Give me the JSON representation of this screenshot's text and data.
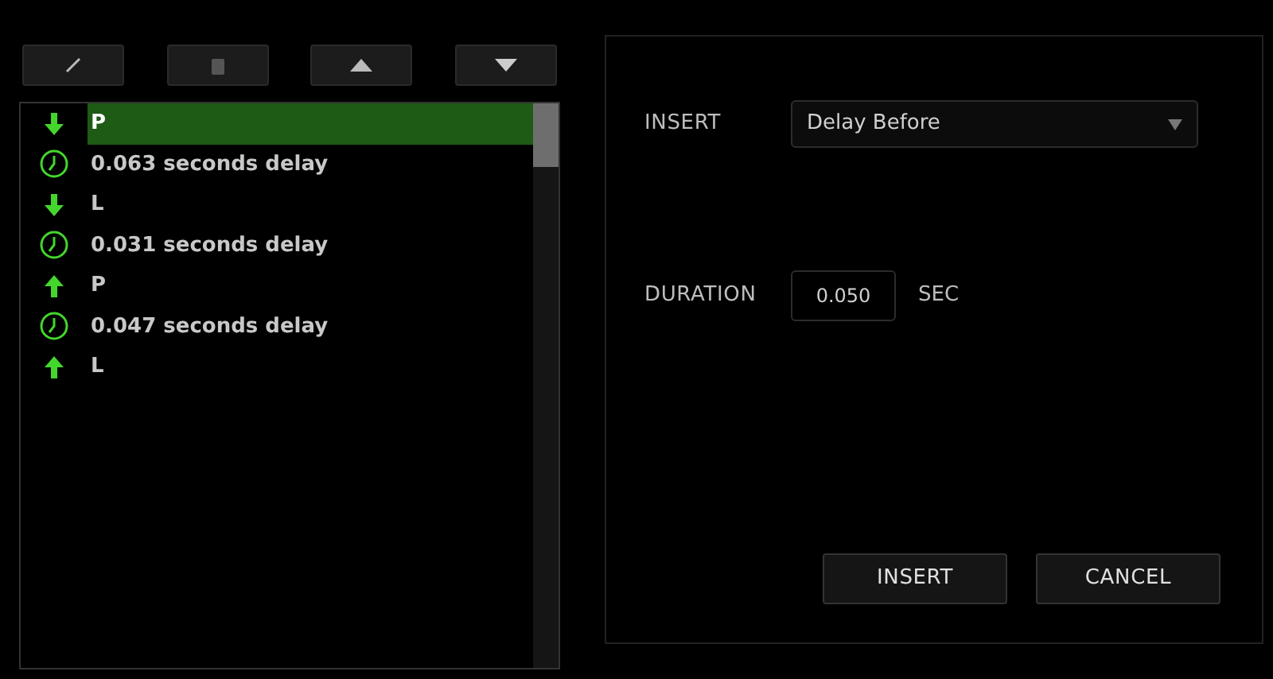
{
  "toolbar": [
    {
      "kind": "edit"
    },
    {
      "kind": "delete"
    },
    {
      "kind": "move-up"
    },
    {
      "kind": "move-down"
    }
  ],
  "events": [
    {
      "kind": "key-down",
      "label": "P",
      "selected": true
    },
    {
      "kind": "delay",
      "label": "0.063 seconds delay",
      "selected": false
    },
    {
      "kind": "key-down",
      "label": "L",
      "selected": false
    },
    {
      "kind": "delay",
      "label": "0.031 seconds delay",
      "selected": false
    },
    {
      "kind": "key-up",
      "label": "P",
      "selected": false
    },
    {
      "kind": "delay",
      "label": "0.047 seconds delay",
      "selected": false
    },
    {
      "kind": "key-up",
      "label": "L",
      "selected": false
    }
  ],
  "insert": {
    "label": "INSERT",
    "value": "Delay Before"
  },
  "duration": {
    "label": "DURATION",
    "value": "0.050",
    "unit": "SEC"
  },
  "buttons": [
    "INSERT",
    "CANCEL"
  ]
}
